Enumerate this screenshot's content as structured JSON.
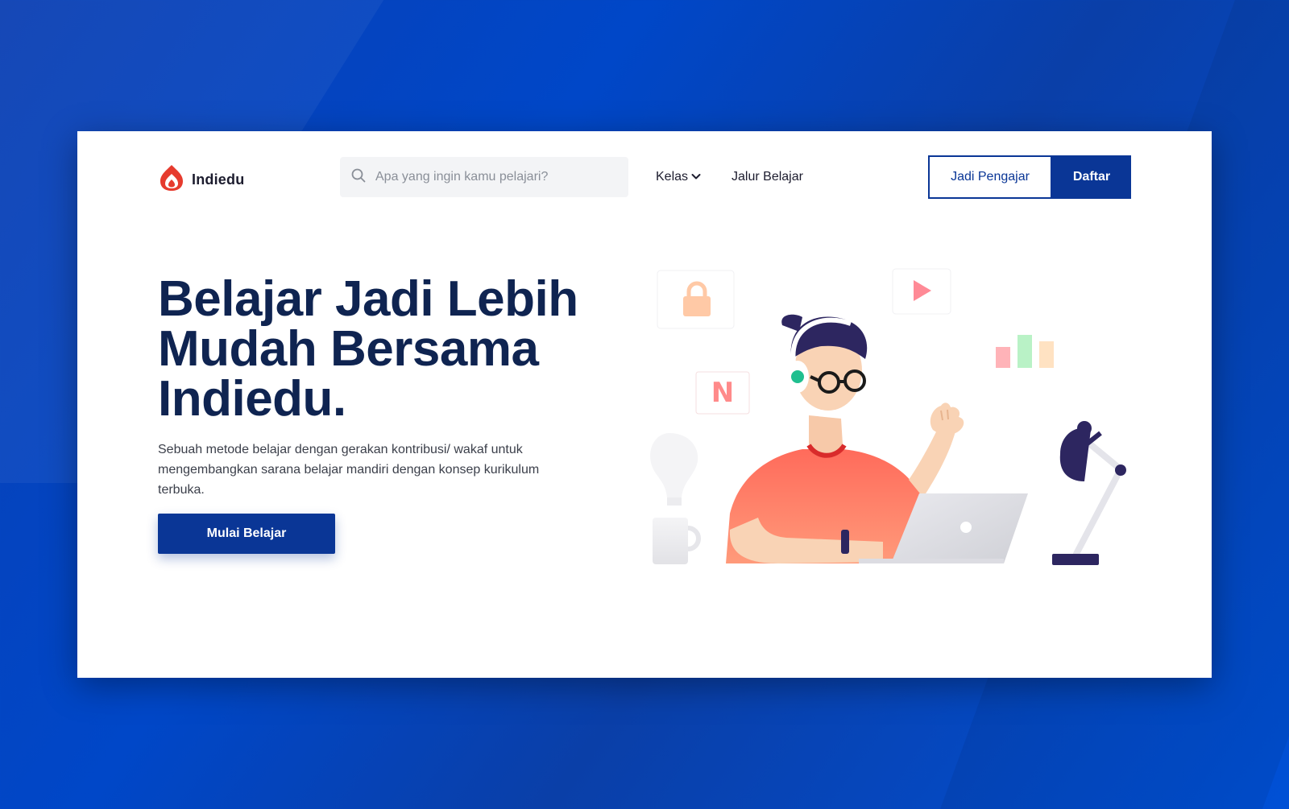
{
  "header": {
    "logo_text": "Indiedu",
    "search_placeholder": "Apa yang ingin kamu pelajari?",
    "nav": [
      {
        "label": "Kelas",
        "has_dropdown": true
      },
      {
        "label": "Jalur Belajar",
        "has_dropdown": false
      }
    ],
    "teacher_button": "Jadi Pengajar",
    "register_button": "Daftar"
  },
  "hero": {
    "title": "Belajar Jadi Lebih Mudah Bersama Indiedu.",
    "description": "Sebuah metode belajar dengan gerakan kontribusi/ wakaf untuk mengembangkan sarana belajar mandiri dengan konsep kurikulum terbuka.",
    "cta_label": "Mulai Belajar"
  },
  "illustration": {
    "icons": [
      "lock-icon",
      "play-icon",
      "bar-chart-icon",
      "n-letter-icon",
      "lightbulb-icon",
      "mug-icon",
      "desk-lamp-icon",
      "laptop-icon"
    ],
    "n_letter": "N"
  },
  "colors": {
    "primary": "#0a3696",
    "title": "#0f2451",
    "accent_red": "#e63b2e",
    "shirt": "#ff6b5b",
    "background": "#0047c8"
  }
}
